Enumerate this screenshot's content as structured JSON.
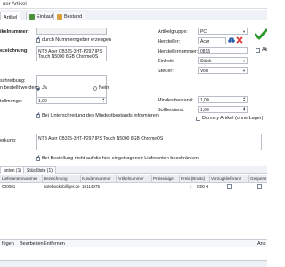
{
  "window": {
    "title": "uer Artikel"
  },
  "tabs": [
    {
      "label": "Artikel",
      "icon": "article-icon",
      "active": true
    },
    {
      "label": "Einkauf",
      "icon": "purchase-icon",
      "active": false
    },
    {
      "label": "Bestand",
      "icon": "stock-icon",
      "active": false
    }
  ],
  "left": {
    "article_number_label": "ikelnummer:",
    "auto_number_label": "durch Nummerngeber erzeugen",
    "auto_number_checked": true,
    "name_label": "ezeichnung:",
    "name_value": "NTB Acer CB315-3HT-P297 IPS Touch N5000 8GB ChromeOS",
    "description_label": "schreibung:",
    "order_label": "n bestellt werden:",
    "order_yes": "Ja",
    "order_no": "Nein",
    "order_selected": "Ja",
    "quantity_label": "tellmenge:",
    "quantity_value": "1,00",
    "notify_label": "Bei Unterschreitung des Mindestbestands informieren",
    "notify_checked": true,
    "remark_label": "erkung:",
    "remark_value": "NTB Acer CB315-3HT-P297 IPS Touch N5000 8GB ChromeOS",
    "restrict_label": "Bei Bestellung nicht auf die hier eingetragenen Lieferanten beschränken",
    "restrict_checked": true
  },
  "right": {
    "group_label": "Artikelgruppe:",
    "group_value": "PC",
    "maker_label": "Hersteller:",
    "maker_value": "Acer",
    "maker_no_label": "Herstellernummer:",
    "maker_no_value": "0815",
    "unit_label": "Einheit:",
    "unit_value": "Stück",
    "tax_label": "Steuer:",
    "tax_value": "Voll",
    "min_stock_label": "Mindestbestand:",
    "min_stock_value": "1,00",
    "target_stock_label": "Sollbestand:",
    "target_stock_value": "1,00",
    "dummy_label": "Dummy Artikel (ohne Lager)",
    "dummy_checked": false,
    "side_label": "Ak"
  },
  "colors": {
    "accent_green": "#2c9a2c",
    "tab_bg": "#eef1f5"
  },
  "bottom_tabs": [
    {
      "label": "anten (1)",
      "active": true
    },
    {
      "label": "Stückliste (1)",
      "active": false
    }
  ],
  "grid": {
    "headers": [
      "Lieferantennummer",
      "Bezeichnung",
      "Kundennummer",
      "Artikelnummer",
      "Preiseinige",
      "Preis (Brutto)",
      "Vorzugslieferant!",
      "Gesperrt"
    ],
    "rows": [
      [
        "000001",
        "notebooksbilliger.de",
        "10114875",
        "",
        "",
        "1",
        "0,00 €",
        ""
      ]
    ]
  },
  "footer": {
    "add": "fügen",
    "edit": "Bearbeiten",
    "remove": "Entfernen",
    "right": "Ans"
  }
}
